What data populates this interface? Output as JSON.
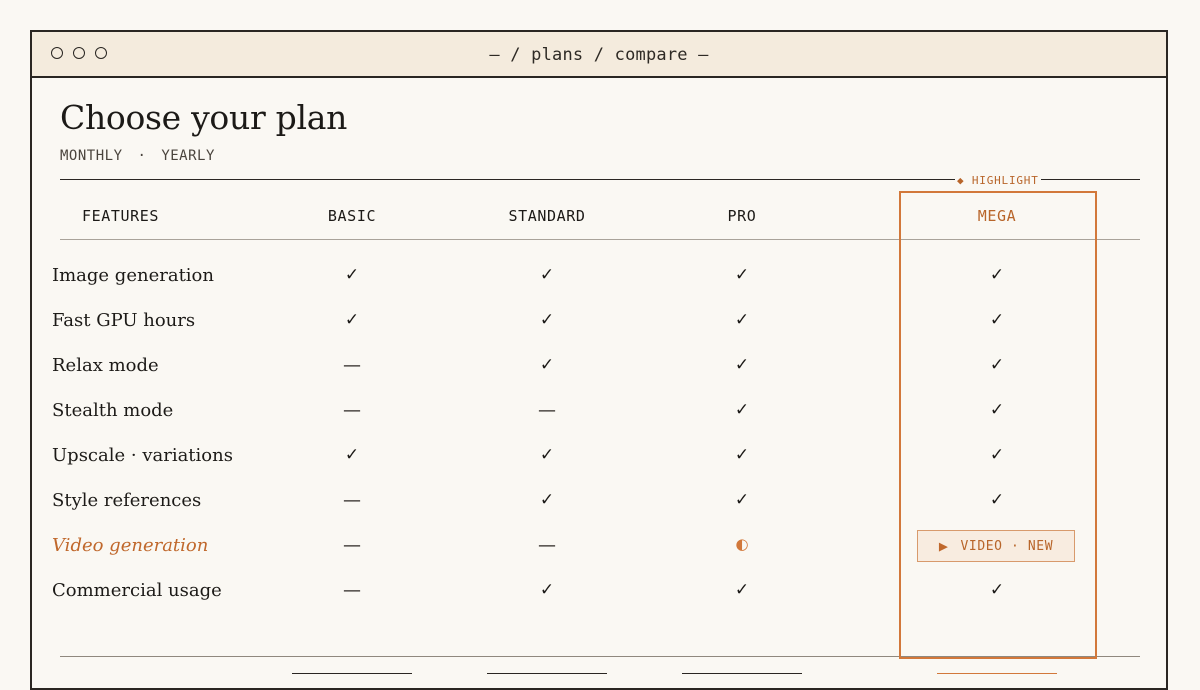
{
  "window": {
    "path": "— / plans / compare —"
  },
  "page": {
    "title": "Choose your plan",
    "billing": {
      "monthly": "MONTHLY",
      "separator": "·",
      "yearly": "YEARLY"
    }
  },
  "table": {
    "features_header": "FEATURES",
    "plans": [
      "BASIC",
      "STANDARD",
      "PRO",
      "MEGA"
    ],
    "highlight_tag": "◆ HIGHLIGHT",
    "rows": [
      {
        "label": "Image generation",
        "cells": [
          "✓",
          "✓",
          "✓",
          "✓"
        ]
      },
      {
        "label": "Fast GPU hours",
        "cells": [
          "✓",
          "✓",
          "✓",
          "✓"
        ]
      },
      {
        "label": "Relax mode",
        "cells": [
          "—",
          "✓",
          "✓",
          "✓"
        ]
      },
      {
        "label": "Stealth mode",
        "cells": [
          "—",
          "—",
          "✓",
          "✓"
        ]
      },
      {
        "label": "Upscale · variations",
        "cells": [
          "✓",
          "✓",
          "✓",
          "✓"
        ]
      },
      {
        "label": "Style references",
        "cells": [
          "—",
          "✓",
          "✓",
          "✓"
        ]
      },
      {
        "label": "Video generation",
        "cells": [
          "—",
          "—",
          "◐",
          "▶ VIDEO · NEW"
        ]
      },
      {
        "label": "Commercial usage",
        "cells": [
          "—",
          "✓",
          "✓",
          "✓"
        ]
      }
    ],
    "video_badge": {
      "icon": "▶",
      "text": "VIDEO · NEW"
    }
  },
  "colors": {
    "accent": "#d2783a",
    "accent_text": "#b8652a",
    "background": "#faf8f3",
    "titlebar": "#f4ebdd",
    "ink": "#1c1a17"
  },
  "icons": {
    "included": "check-icon",
    "excluded": "dash-icon",
    "partial": "half-circle-icon",
    "video": "play-icon"
  }
}
